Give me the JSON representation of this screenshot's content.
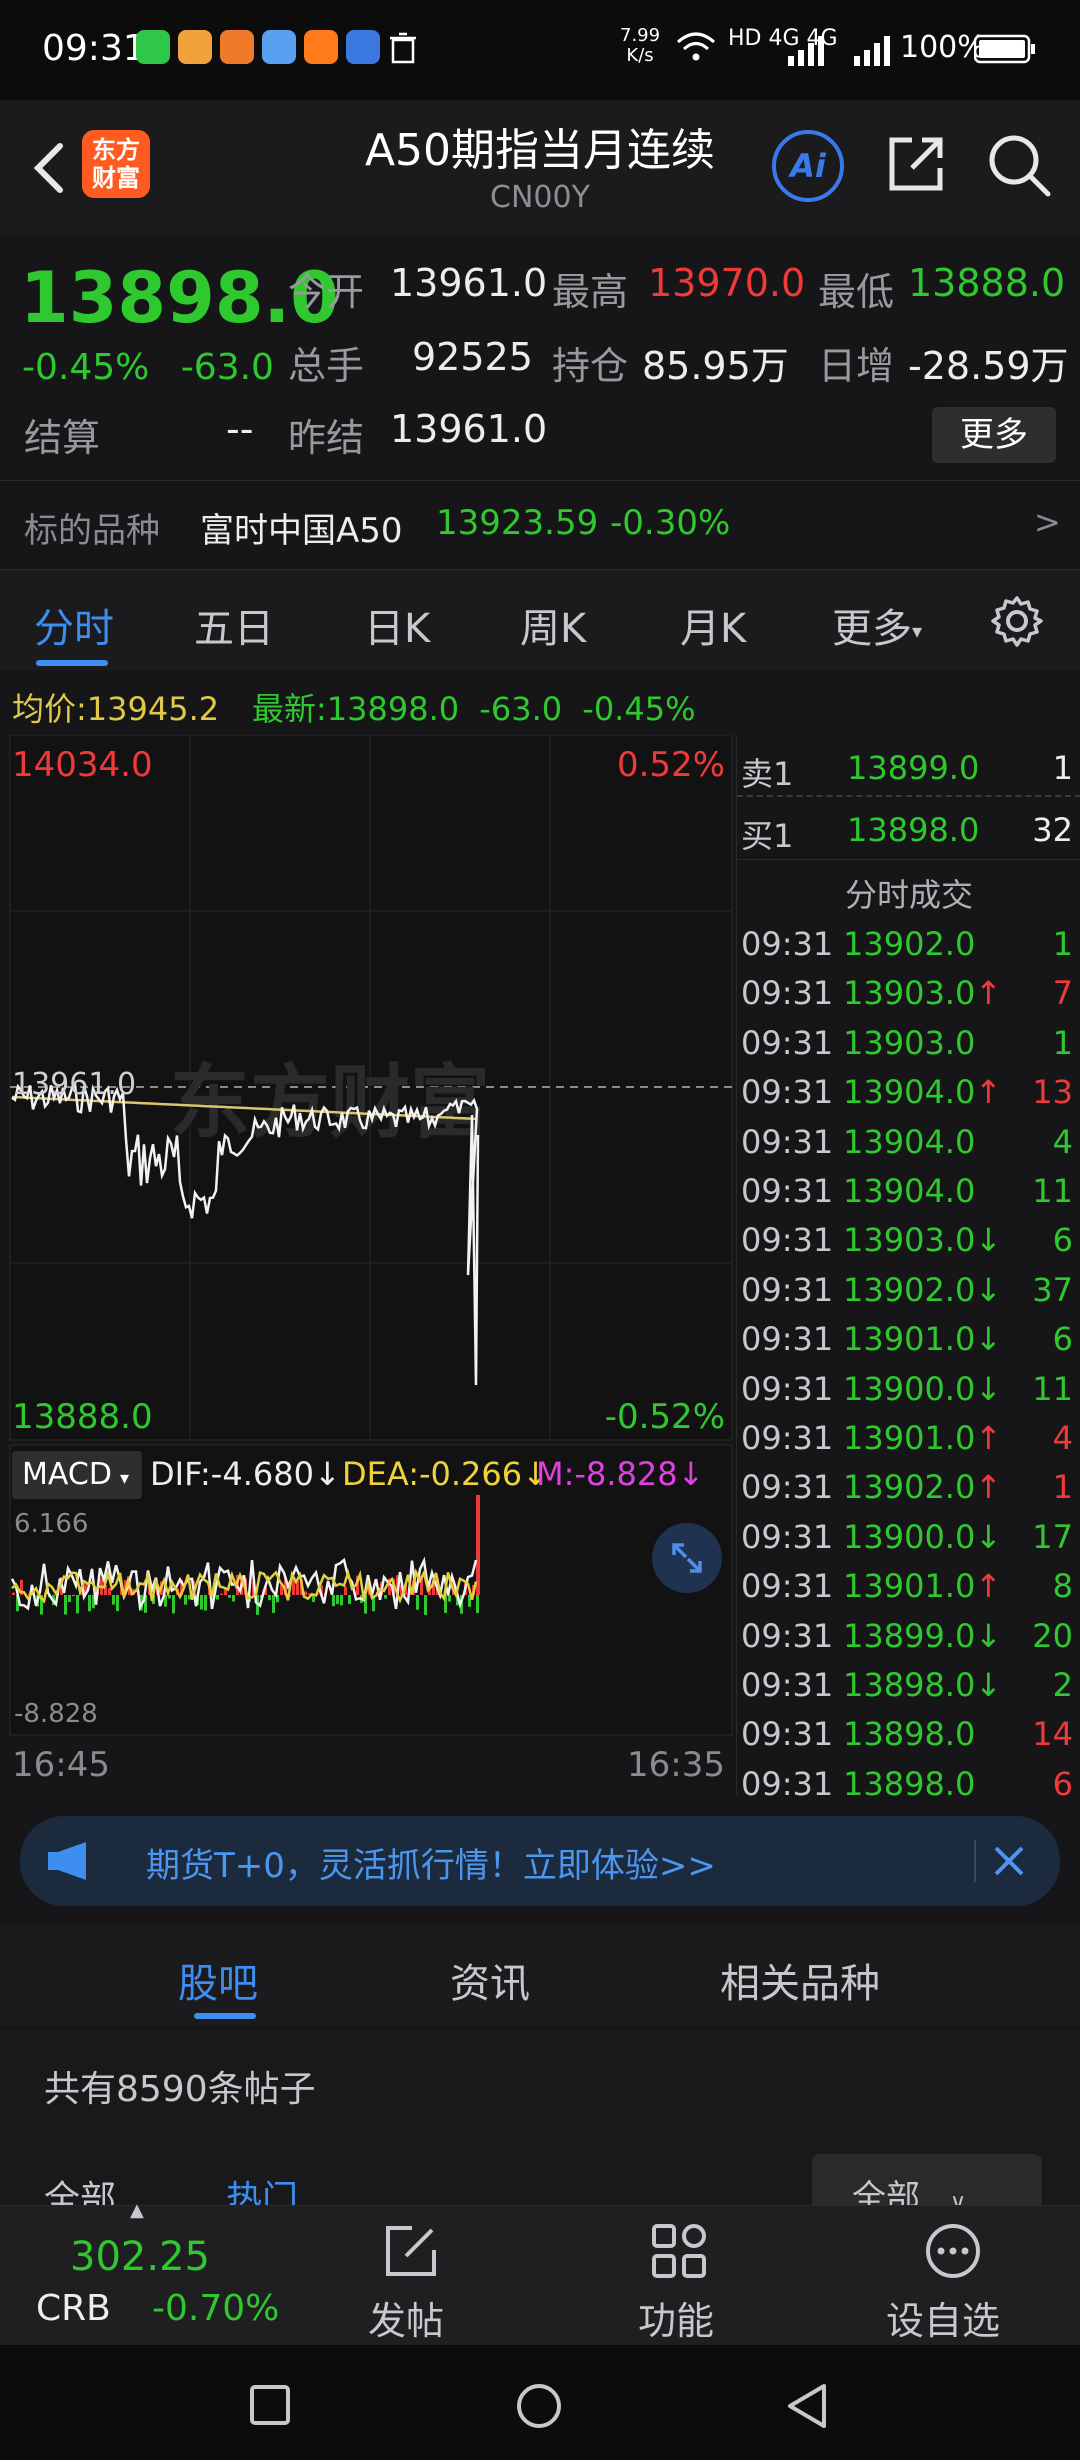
{
  "status": {
    "time": "09:31",
    "net_speed_top": "7.99",
    "net_speed_bottom": "K/s",
    "network": "HD 4G 4G",
    "battery": "100%"
  },
  "header": {
    "logo_line1": "东方",
    "logo_line2": "财富",
    "title": "A50期指当月连续",
    "code": "CN00Y",
    "ai_label": "Ai"
  },
  "quote": {
    "price": "13898.0",
    "change_pct": "-0.45%",
    "change": "-63.0",
    "settle_label": "结算",
    "settle_value": "--",
    "open_label": "今开",
    "open_value": "13961.0",
    "high_label": "最高",
    "high_value": "13970.0",
    "low_label": "最低",
    "low_value": "13888.0",
    "volume_label": "总手",
    "volume_value": "92525",
    "oi_label": "持仓",
    "oi_value": "85.95万",
    "daily_inc_label": "日增",
    "daily_inc_value": "-28.59万",
    "prev_settle_label": "昨结",
    "prev_settle_value": "13961.0",
    "more_label": "更多"
  },
  "underlying": {
    "label": "标的品种",
    "name": "富时中国A50",
    "price": "13923.59",
    "pct": "-0.30%",
    "arrow": ">"
  },
  "tabs": [
    "分时",
    "五日",
    "日K",
    "周K",
    "月K",
    "更多"
  ],
  "active_tab": 0,
  "avgline": {
    "avg_label": "均价:",
    "avg_value": "13945.2",
    "latest_label": "最新:",
    "latest_value": "13898.0",
    "latest_change": "-63.0",
    "latest_pct": "-0.45%"
  },
  "chart": {
    "top_price": "14034.0",
    "top_pct": "0.52%",
    "mid_price": "13961.0",
    "bottom_price": "13888.0",
    "bottom_pct": "-0.52%",
    "watermark": "东方财富",
    "macd_label": "MACD",
    "dif": "DIF:-4.680",
    "dea": "DEA:-0.266",
    "m": "M:-8.828",
    "macd_top": "6.166",
    "macd_bottom": "-8.828",
    "time_start": "16:45",
    "time_end": "16:35",
    "colors": {
      "price_line": "#f2f2f2",
      "avg_line": "#d9c66a",
      "up": "#f03a3a",
      "down": "#2fc82f"
    }
  },
  "orderbook": {
    "ask_label": "卖1",
    "ask_price": "13899.0",
    "ask_vol": "1",
    "bid_label": "买1",
    "bid_price": "13898.0",
    "bid_vol": "32",
    "trades_title": "分时成交",
    "trades": [
      {
        "t": "09:31",
        "p": "13902.0",
        "a": "",
        "v": "1",
        "vc": "green"
      },
      {
        "t": "09:31",
        "p": "13903.0",
        "a": "↑",
        "v": "7",
        "vc": "red"
      },
      {
        "t": "09:31",
        "p": "13903.0",
        "a": "",
        "v": "1",
        "vc": "green"
      },
      {
        "t": "09:31",
        "p": "13904.0",
        "a": "↑",
        "v": "13",
        "vc": "red"
      },
      {
        "t": "09:31",
        "p": "13904.0",
        "a": "",
        "v": "4",
        "vc": "green"
      },
      {
        "t": "09:31",
        "p": "13904.0",
        "a": "",
        "v": "11",
        "vc": "green"
      },
      {
        "t": "09:31",
        "p": "13903.0",
        "a": "↓",
        "v": "6",
        "vc": "green"
      },
      {
        "t": "09:31",
        "p": "13902.0",
        "a": "↓",
        "v": "37",
        "vc": "green"
      },
      {
        "t": "09:31",
        "p": "13901.0",
        "a": "↓",
        "v": "6",
        "vc": "green"
      },
      {
        "t": "09:31",
        "p": "13900.0",
        "a": "↓",
        "v": "11",
        "vc": "green"
      },
      {
        "t": "09:31",
        "p": "13901.0",
        "a": "↑",
        "v": "4",
        "vc": "red"
      },
      {
        "t": "09:31",
        "p": "13902.0",
        "a": "↑",
        "v": "1",
        "vc": "red"
      },
      {
        "t": "09:31",
        "p": "13900.0",
        "a": "↓",
        "v": "17",
        "vc": "green"
      },
      {
        "t": "09:31",
        "p": "13901.0",
        "a": "↑",
        "v": "8",
        "vc": "green"
      },
      {
        "t": "09:31",
        "p": "13899.0",
        "a": "↓",
        "v": "20",
        "vc": "green"
      },
      {
        "t": "09:31",
        "p": "13898.0",
        "a": "↓",
        "v": "2",
        "vc": "green"
      },
      {
        "t": "09:31",
        "p": "13898.0",
        "a": "",
        "v": "14",
        "vc": "red"
      },
      {
        "t": "09:31",
        "p": "13898.0",
        "a": "",
        "v": "6",
        "vc": "red"
      }
    ]
  },
  "banner": {
    "text": "期货T+0，灵活抓行情！立即体验>>"
  },
  "bottom_tabs": [
    "股吧",
    "资讯",
    "相关品种"
  ],
  "posts": {
    "count_text": "共有8590条帖子",
    "filter1": "全部",
    "filter2": "热门",
    "sort": "全部"
  },
  "bottom_nav": {
    "crb_value": "302.25",
    "crb_label": "CRB",
    "crb_pct": "-0.70%",
    "post_label": "发帖",
    "func_label": "功能",
    "watch_label": "设自选"
  }
}
